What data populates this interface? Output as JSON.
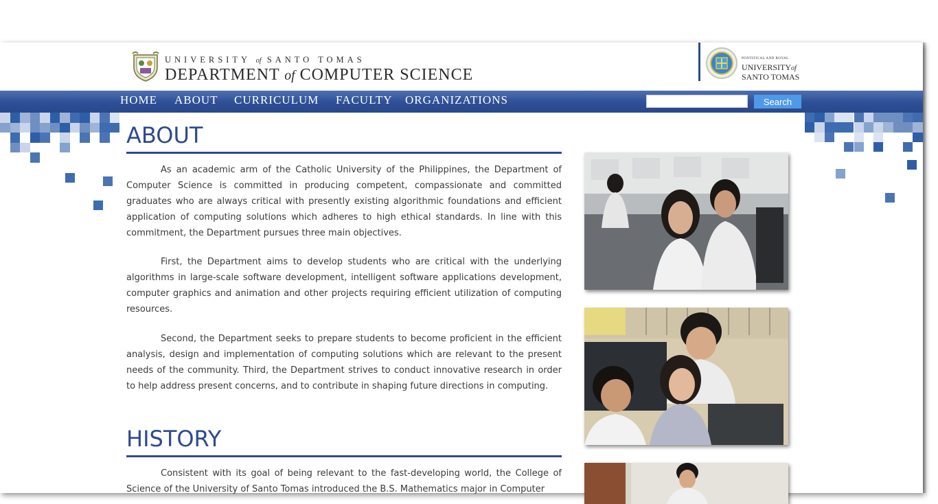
{
  "header": {
    "university_line": [
      "UNIVERSITY",
      "of",
      "SANTO TOMAS"
    ],
    "department_line": [
      "DEPARTMENT",
      "of",
      "COMPUTER SCIENCE"
    ],
    "partner_small": "PONTIFICAL AND ROYAL",
    "partner_line1": [
      "UNIVERSITY",
      "of"
    ],
    "partner_line2": "SANTO TOMAS"
  },
  "nav": {
    "items": [
      "HOME",
      "ABOUT",
      "CURRICULUM",
      "FACULTY",
      "ORGANIZATIONS"
    ],
    "search_value": "",
    "search_button": "Search"
  },
  "content": {
    "about_title": "ABOUT",
    "about_paragraphs": [
      "As an academic arm of the Catholic University of the Philippines, the Department of Computer Science is committed in producing competent, compassionate and committed graduates who are always critical with presently existing algorithmic foundations and efficient application of computing solutions which adheres to high ethical standards. In line with this commitment, the Department pursues three main objectives.",
      "First, the Department aims to develop students who are critical with the underlying algorithms in large-scale software development, intelligent software applications development, computer graphics and animation and other projects requiring efficient utilization of computing resources.",
      "Second, the Department seeks to prepare students to become proficient in the efficient analysis, design and implementation of computing solutions which are relevant to the present needs of the community. Third, the Department strives to conduct innovative research in order to help address present concerns, and to contribute in shaping future directions in computing."
    ],
    "history_title": "HISTORY",
    "history_paragraph": "Consistent with its goal of being relevant to the fast-developing world, the College of Science of the University of Santo Tomas introduced the B.S. Mathematics major in Computer"
  },
  "colors": {
    "brand_blue": "#2e4a8e",
    "nav_gradient_top": "#4f6fb0",
    "search_button": "#4f9ae8",
    "body_text": "#3a3a3a"
  },
  "icons": {
    "department_logo": "ust-crest-icon",
    "partner_logo": "ust-seal-icon"
  }
}
